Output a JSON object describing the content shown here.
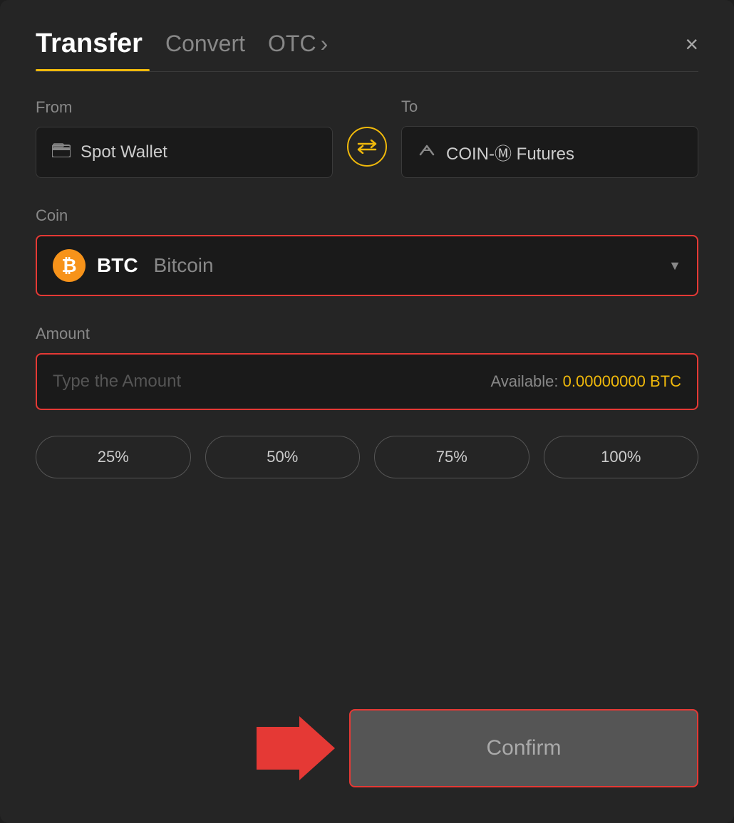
{
  "header": {
    "title_active": "Transfer",
    "tab_convert": "Convert",
    "tab_otc": "OTC",
    "close_label": "×"
  },
  "from": {
    "label": "From",
    "wallet_name": "Spot Wallet"
  },
  "to": {
    "label": "To",
    "wallet_name": "COIN-Ⓜ Futures"
  },
  "coin": {
    "label": "Coin",
    "symbol": "BTC",
    "name": "Bitcoin"
  },
  "amount": {
    "label": "Amount",
    "placeholder": "Type the Amount",
    "available_label": "Available:",
    "available_value": "0.00000000 BTC"
  },
  "percent_buttons": [
    "25%",
    "50%",
    "75%",
    "100%"
  ],
  "confirm_button": {
    "label": "Confirm"
  }
}
